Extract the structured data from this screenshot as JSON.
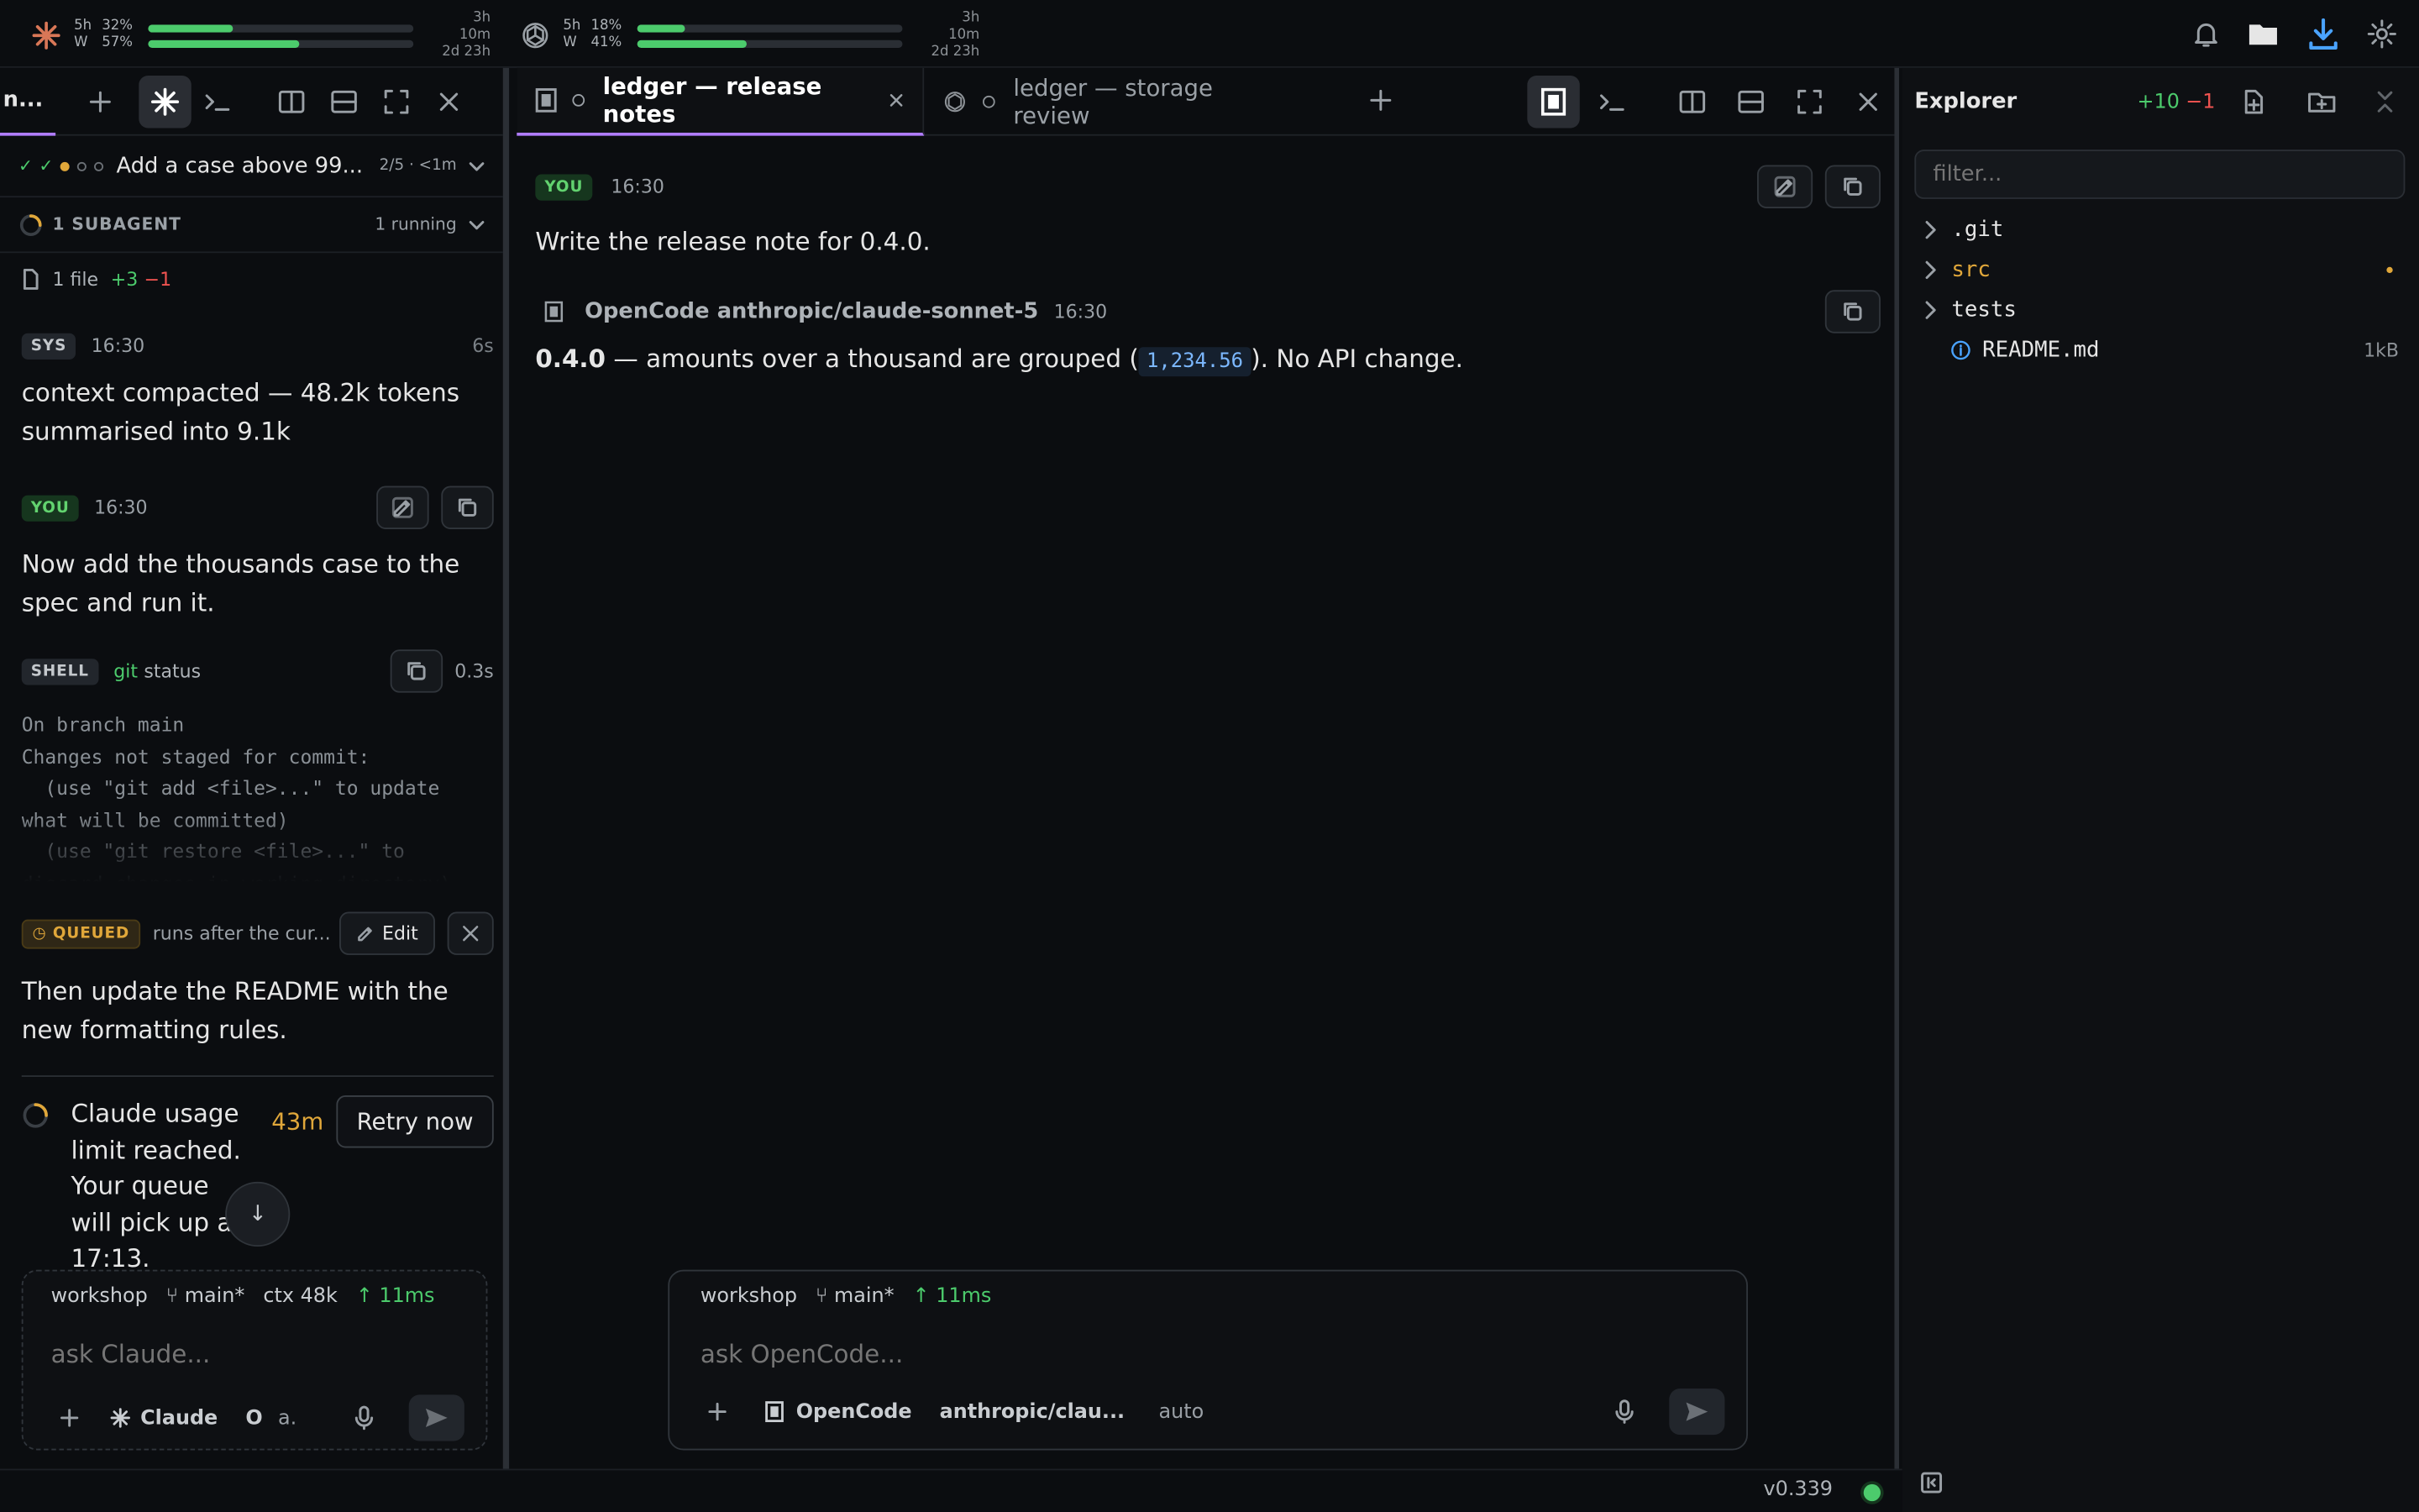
{
  "usage": [
    {
      "windows": [
        "5h",
        "W"
      ],
      "percents": [
        "32%",
        "57%"
      ],
      "fills": [
        0.32,
        0.57
      ],
      "resets": [
        "3h 10m",
        "2d 23h"
      ],
      "icon": "claude-icon"
    },
    {
      "windows": [
        "5h",
        "W"
      ],
      "percents": [
        "18%",
        "41%"
      ],
      "fills": [
        0.18,
        0.41
      ],
      "resets": [
        "3h 10m",
        "2d 23h"
      ],
      "icon": "openai-icon"
    }
  ],
  "left": {
    "tab_fragment": "n...",
    "todo": {
      "title": "Add a case above 99...",
      "meta": "2/5 · <1m"
    },
    "subagent": {
      "label": "1 SUBAGENT",
      "status": "1 running"
    },
    "files": {
      "label": "1 file",
      "added": "+3",
      "removed": "−1"
    },
    "sys": {
      "badge": "SYS",
      "time": "16:30",
      "dur": "6s",
      "text": "context compacted — 48.2k tokens summarised into 9.1k"
    },
    "you": {
      "badge": "YOU",
      "time": "16:30",
      "text": "Now add the thousands case to the spec and run it."
    },
    "shell": {
      "badge": "SHELL",
      "cmd": "git",
      "args": "status",
      "dur": "0.3s",
      "output": "On branch main\nChanges not staged for commit:\n  (use \"git add <file>...\" to update\nwhat will be committed)\n  (use \"git restore <file>...\" to\ndiscard changes in working directory)"
    },
    "queued": {
      "badge": "QUEUED",
      "note": "runs after the cur...",
      "edit": "Edit",
      "text": "Then update the README with the new formatting rules."
    },
    "limit": {
      "text": "Claude usage limit reached. Your queue will pick up at 17:13.",
      "eta": "43m",
      "retry": "Retry now"
    },
    "composer": {
      "workspace": "workshop",
      "branch": "main*",
      "ctx": "ctx 48k",
      "latency": "↑ 11ms",
      "placeholder": "ask Claude...",
      "agent": "Claude",
      "mode": "O",
      "mode2": "a."
    }
  },
  "center": {
    "tabs": [
      {
        "label": "ledger — release notes",
        "active": true
      },
      {
        "label": "ledger — storage review",
        "active": false
      }
    ],
    "you": {
      "badge": "YOU",
      "time": "16:30",
      "text": "Write the release note for 0.4.0."
    },
    "reply": {
      "agent": "OpenCode",
      "model": "anthropic/claude-sonnet-5",
      "time": "16:30",
      "version": "0.4.0",
      "pre": " — amounts over a thousand are grouped (",
      "code": "1,234.56",
      "post": "). No API change."
    },
    "composer": {
      "workspace": "workshop",
      "branch": "main*",
      "latency": "↑ 11ms",
      "placeholder": "ask OpenCode...",
      "agent": "OpenCode",
      "model": "anthropic/clau...",
      "mode": "auto"
    }
  },
  "explorer": {
    "title": "Explorer",
    "added": "+10",
    "removed": "−1",
    "filter_placeholder": "filter...",
    "items": [
      {
        "name": ".git",
        "type": "folder"
      },
      {
        "name": "src",
        "type": "folder",
        "modified": true
      },
      {
        "name": "tests",
        "type": "folder"
      },
      {
        "name": "README.md",
        "type": "file",
        "size": "1kB"
      }
    ]
  },
  "status": {
    "version": "v0.339"
  },
  "colors": {
    "accent": "#b07cff",
    "green": "#4ccb6c",
    "amber": "#e0a73a",
    "red": "#ef5350"
  }
}
